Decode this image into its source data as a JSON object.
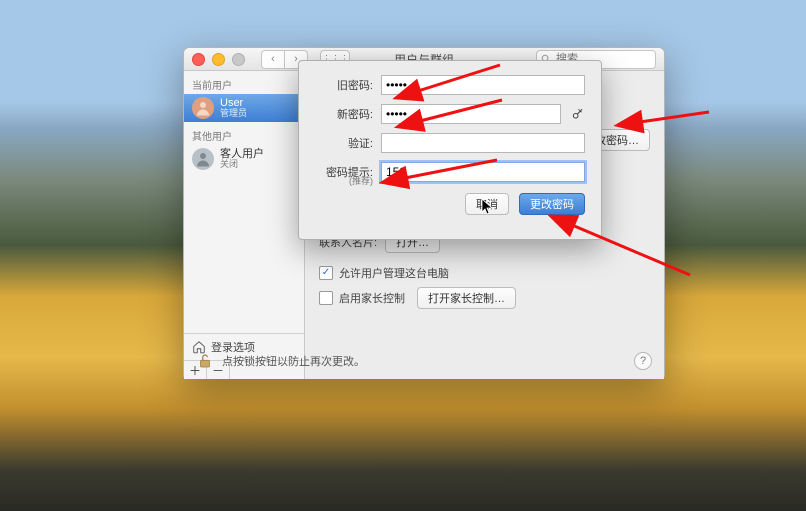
{
  "window": {
    "title": "用户与群组",
    "search_placeholder": "搜索"
  },
  "sidebar": {
    "current_label": "当前用户",
    "other_label": "其他用户",
    "users": [
      {
        "name": "User",
        "role": "管理员",
        "selected": true,
        "avatar_color": "#e0a080"
      },
      {
        "name": "客人用户",
        "role": "关闭",
        "selected": false,
        "avatar_color": "#9aa3ad"
      }
    ],
    "login_options": "登录选项"
  },
  "main": {
    "change_password_btn": "更改密码…",
    "contact_card_label": "联系人名片:",
    "open_btn": "打开…",
    "allow_admin_checkbox": "允许用户管理这台电脑",
    "allow_admin_checked": true,
    "parental_label": "启用家长控制",
    "parental_checked": false,
    "parental_btn": "打开家长控制…",
    "lock_text": "点按锁按钮以防止再次更改。"
  },
  "sheet": {
    "old_pw_label": "旧密码:",
    "old_pw_value": "•••••",
    "new_pw_label": "新密码:",
    "new_pw_value": "•••••",
    "verify_label": "验证:",
    "verify_value": "",
    "hint_label": "密码提示:",
    "hint_sub": "(推荐)",
    "hint_value": "159",
    "cancel": "取消",
    "confirm": "更改密码"
  }
}
